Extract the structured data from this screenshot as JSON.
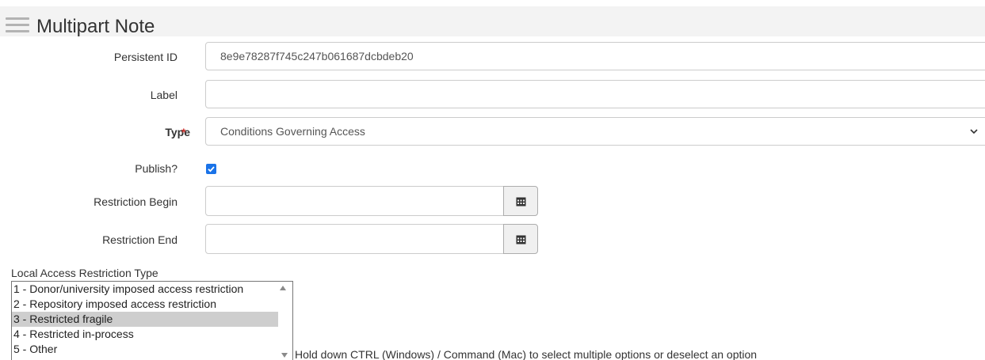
{
  "header": {
    "title": "Multipart Note",
    "menu_icon": "hamburger-menu-icon"
  },
  "form": {
    "persistent_id": {
      "label": "Persistent ID",
      "value": "8e9e78287f745c247b061687dcbdeb20"
    },
    "label_field": {
      "label": "Label",
      "value": ""
    },
    "type": {
      "label": "Type",
      "required_marker": "*",
      "selected": "Conditions Governing Access"
    },
    "publish": {
      "label": "Publish?",
      "checked": true
    },
    "restriction_begin": {
      "label": "Restriction Begin",
      "value": "",
      "icon": "calendar-icon"
    },
    "restriction_end": {
      "label": "Restriction End",
      "value": "",
      "icon": "calendar-icon"
    }
  },
  "local_access": {
    "label": "Local Access Restriction Type",
    "options": [
      {
        "label": "1 - Donor/university imposed access restriction",
        "selected": false
      },
      {
        "label": "2 - Repository imposed access restriction",
        "selected": false
      },
      {
        "label": "3 - Restricted fragile",
        "selected": true
      },
      {
        "label": "4 - Restricted in-process",
        "selected": false
      },
      {
        "label": "5 - Other",
        "selected": false
      }
    ],
    "help_text": "Hold down CTRL (Windows) / Command (Mac) to select multiple options or deselect an option"
  },
  "colors": {
    "header_bg": "#f3f3f3",
    "required": "#c9302c",
    "checkbox": "#1a73e8",
    "selected_option_bg": "#cecece"
  }
}
